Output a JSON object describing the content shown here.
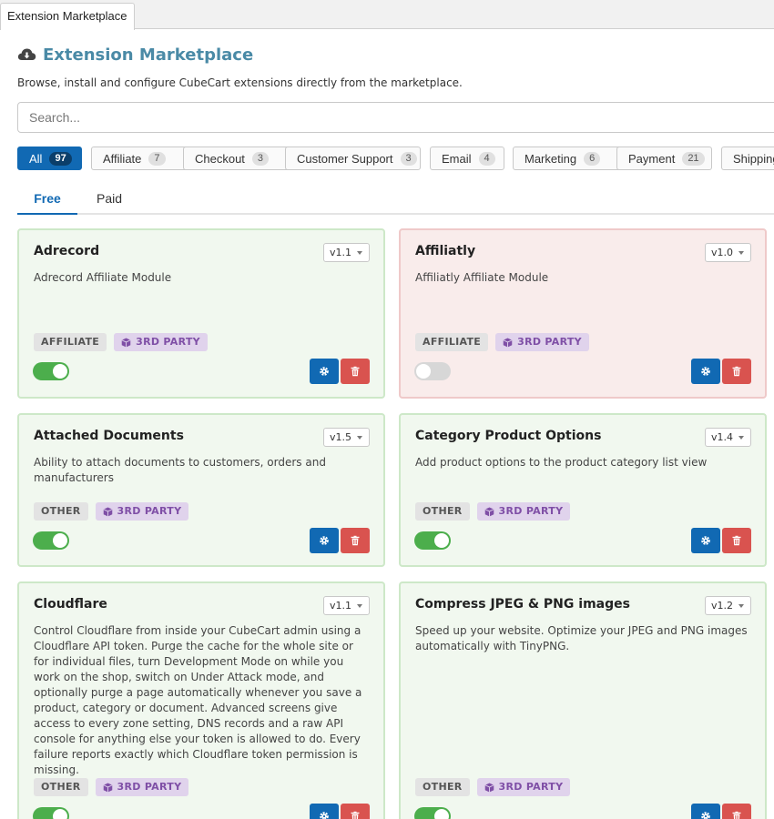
{
  "window_tab": "Extension Marketplace",
  "header": {
    "title": "Extension Marketplace",
    "subtitle": "Browse, install and configure CubeCart extensions directly from the marketplace.",
    "icon": "cloud-download-icon"
  },
  "search": {
    "placeholder": "Search...",
    "value": ""
  },
  "filters": [
    {
      "label": "All",
      "count": "97",
      "active": true
    },
    {
      "label": "Affiliate",
      "count": "7"
    },
    {
      "label": "Checkout",
      "count": "3"
    },
    {
      "label": "Customer Support",
      "count": "3"
    },
    {
      "label": "Email",
      "count": "4"
    },
    {
      "label": "Marketing",
      "count": "6"
    },
    {
      "label": "Payment",
      "count": "21"
    },
    {
      "label": "Shipping"
    }
  ],
  "tabs": [
    {
      "label": "Free",
      "active": true
    },
    {
      "label": "Paid"
    }
  ],
  "third_party_label": "3RD PARTY",
  "colors": {
    "accent": "#1169b3",
    "enabled_card": "#f1f8ef",
    "disabled_card": "#f9eceb",
    "toggle_on": "#4cae4c",
    "delete": "#d9534f",
    "third_party": "#7f4fa6"
  },
  "extensions": [
    {
      "name": "Adrecord",
      "version": "v1.1",
      "description": "Adrecord Affiliate Module",
      "category": "AFFILIATE",
      "third_party": true,
      "enabled": true
    },
    {
      "name": "Affiliatly",
      "version": "v1.0",
      "description": "Affiliatly Affiliate Module",
      "category": "AFFILIATE",
      "third_party": true,
      "enabled": false
    },
    {
      "name": "Attached Documents",
      "version": "v1.5",
      "description": "Ability to attach documents to customers, orders and manufacturers",
      "category": "OTHER",
      "third_party": true,
      "enabled": true
    },
    {
      "name": "Category Product Options",
      "version": "v1.4",
      "description": "Add product options to the product category list view",
      "category": "OTHER",
      "third_party": true,
      "enabled": true
    },
    {
      "name": "Cloudflare",
      "version": "v1.1",
      "description": "Control Cloudflare from inside your CubeCart admin using a Cloudflare API token. Purge the cache for the whole site or for individual files, turn Development Mode on while you work on the shop, switch on Under Attack mode, and optionally purge a page automatically whenever you save a product, category or document. Advanced screens give access to every zone setting, DNS records and a raw API console for anything else your token is allowed to do. Every failure reports exactly which Cloudflare token permission is missing.",
      "category": "OTHER",
      "third_party": true,
      "enabled": true
    },
    {
      "name": "Compress JPEG & PNG images",
      "version": "v1.2",
      "description": "Speed up your website. Optimize your JPEG and PNG images automatically with TinyPNG.",
      "category": "OTHER",
      "third_party": true,
      "enabled": true
    }
  ]
}
